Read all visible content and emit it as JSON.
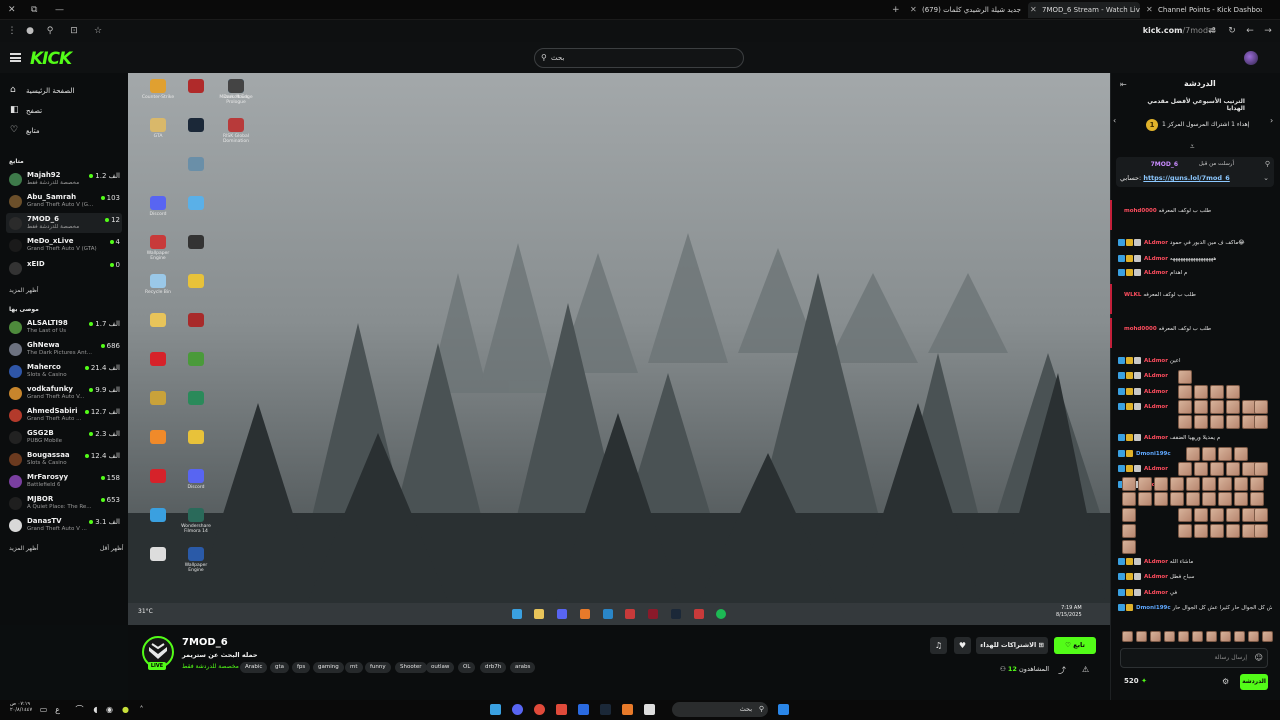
{
  "browser": {
    "tabs": [
      {
        "title": "Channel Points - Kick Dashboar",
        "active": false,
        "favicon_color": "#53fc18"
      },
      {
        "title": "7MOD_6 Stream - Watch Live o",
        "active": true,
        "favicon_color": "#53fc18"
      },
      {
        "title": "(679) جديد شيلة الرشيدي كلمات",
        "active": false,
        "favicon_color": "#ff0033"
      }
    ],
    "url_host": "kick.com",
    "url_path": "/7mod-6"
  },
  "header": {
    "logo": "KICK",
    "search_placeholder": "بحث"
  },
  "sidebar": {
    "nav": [
      {
        "label": "الصفحة الرئيسية",
        "icon": "home-icon",
        "glyph": "⌂"
      },
      {
        "label": "تصفح",
        "icon": "browse-icon",
        "glyph": "◧"
      },
      {
        "label": "متابع",
        "icon": "heart-icon",
        "glyph": "♡"
      }
    ],
    "following_heading": "متابع",
    "following": [
      {
        "name": "Majah92",
        "game": "مخصصة للدردشة فقط",
        "viewers": "الف 1.2",
        "avatar": "#3e7a4a"
      },
      {
        "name": "Abu_Samrah",
        "game": "Grand Theft Auto V (G...",
        "viewers": "103",
        "avatar": "#6b4f2a"
      },
      {
        "name": "7MOD_6",
        "game": "مخصصة للدردشة فقط",
        "viewers": "12",
        "avatar": "#2b2b2b"
      },
      {
        "name": "MeDo_xLive",
        "game": "Grand Theft Auto V (GTA)",
        "viewers": "4",
        "avatar": "#1a1a1a"
      },
      {
        "name": "xEID",
        "game": "",
        "viewers": "0",
        "avatar": "#333"
      }
    ],
    "show_more_1": "أظهر المزيد",
    "recommended_heading": "موصى بها",
    "recommended": [
      {
        "name": "ALSALTI98",
        "game": "The Last of Us",
        "viewers": "الف 1.7",
        "avatar": "#4e8a3c"
      },
      {
        "name": "GhNewa",
        "game": "The Dark Pictures Ant...",
        "viewers": "686",
        "avatar": "#6d7280"
      },
      {
        "name": "Maherco",
        "game": "Slots & Casino",
        "viewers": "الف 21.4",
        "avatar": "#2f56a8"
      },
      {
        "name": "vodkafunky",
        "game": "Grand Theft Auto V...",
        "viewers": "الف 9.9",
        "avatar": "#c7852c"
      },
      {
        "name": "AhmedSabiri",
        "game": "Grand Theft Auto ...",
        "viewers": "الف 12.7",
        "avatar": "#b33a2b"
      },
      {
        "name": "GSG2B",
        "game": "PUBG Mobile",
        "viewers": "الف 2.3",
        "avatar": "#222"
      },
      {
        "name": "Bougassaa",
        "game": "Slots & Casino",
        "viewers": "الف 12.4",
        "avatar": "#6b3a1f"
      },
      {
        "name": "MrFarosyy",
        "game": "Battlefield 6",
        "viewers": "158",
        "avatar": "#7a3fa0"
      },
      {
        "name": "MJBOR",
        "game": "A Quiet Place: The Re...",
        "viewers": "653",
        "avatar": "#1f1f1f"
      },
      {
        "name": "DanasTV",
        "game": "Grand Theft Auto V ...",
        "viewers": "الف 3.1",
        "avatar": "#d8d8d8"
      }
    ],
    "show_more_2": "أظهر المزيد",
    "show_less": "أظهر أقل"
  },
  "desktop": {
    "icons": [
      {
        "label": "Counter-Strike",
        "color": "#e0a030"
      },
      {
        "label": "GTA",
        "color": "#d9b86a"
      },
      {
        "label": "Microsoft Edge",
        "color": "#3aa0e0"
      },
      {
        "label": "Discord",
        "color": "#5865f2"
      },
      {
        "label": "Wallpaper Engine",
        "color": "#c83a3a"
      },
      {
        "label": "Recycle Bin",
        "color": "#9ac8e8"
      },
      {
        "label": "",
        "color": "#e8c45a"
      },
      {
        "label": "",
        "color": "#d6222a"
      },
      {
        "label": "",
        "color": "#c9a23a"
      },
      {
        "label": "",
        "color": "#f08a2a"
      },
      {
        "label": "",
        "color": "#d6222a"
      },
      {
        "label": "",
        "color": "#3aa0e0"
      },
      {
        "label": "",
        "color": "#ddd"
      },
      {
        "label": "",
        "color": "#b02a2a"
      },
      {
        "label": "",
        "color": "#1b2838"
      },
      {
        "label": "",
        "color": "#6a8fa8"
      },
      {
        "label": "",
        "color": "#5ab0e8"
      },
      {
        "label": "",
        "color": "#333"
      },
      {
        "label": "",
        "color": "#e8c23a"
      },
      {
        "label": "",
        "color": "#a82a2a"
      },
      {
        "label": "",
        "color": "#4a9a3a"
      },
      {
        "label": "",
        "color": "#2a8a5a"
      },
      {
        "label": "",
        "color": "#e8c23a"
      },
      {
        "label": "Discord",
        "color": "#5865f2"
      },
      {
        "label": "Wondershare Filmora 14",
        "color": "#2a6a5a"
      },
      {
        "label": "Wallpaper Engine",
        "color": "#2a5aa8"
      },
      {
        "label": "Dark Hours Prologue",
        "color": "#444"
      },
      {
        "label": "RISK Global Domination",
        "color": "#b83a3a"
      },
      {
        "label": "HAXKED",
        "color": "#ddd"
      }
    ],
    "taskbar_time": "7:19 AM",
    "taskbar_date": "8/15/2025",
    "weather": "31°C"
  },
  "chat": {
    "title": "الدردشة",
    "leaderboard": "الترتيب الأسبوعي لأفضل مقدمي الهدايا",
    "gift_line": "إهداء 1 اشتراك المرسول المركز 1",
    "gift_rank": "1",
    "pinned_user": "7MOD_6",
    "pinned_label": "أرسلت من قبل",
    "pinned_text": "حسابي:",
    "pinned_link": "https://guns.lol/7mod_6",
    "messages": [
      {
        "user": "mohd0000",
        "text": "طلب ب لوكف المعرفه",
        "color": "red",
        "badges": 0
      },
      {
        "user": "ALdmor",
        "text": "ماكف ف مين الدبور في حمود😂",
        "color": "red",
        "badges": 3
      },
      {
        "user": "ALdmor",
        "text": "هههههههههههههههههه",
        "color": "red",
        "badges": 3
      },
      {
        "user": "ALdmor",
        "text": "م اهدام",
        "color": "red",
        "badges": 3
      },
      {
        "user": "WLKL",
        "text": "طلب ب لوكف المعرفه",
        "color": "red",
        "badges": 0
      },
      {
        "user": "mohd0000",
        "text": "طلب ب لوكف المعرفه",
        "color": "red",
        "badges": 0
      },
      {
        "user": "ALdmor",
        "text": "اعين",
        "color": "red",
        "badges": 3
      },
      {
        "user": "ALdmor",
        "text": "",
        "color": "red",
        "badges": 3
      },
      {
        "user": "ALdmor",
        "text": "",
        "color": "red",
        "badges": 3
      },
      {
        "user": "ALdmor",
        "text": "",
        "color": "red",
        "badges": 3
      },
      {
        "user": "ALdmor",
        "text": "م يمديلا وريهيا الضفف",
        "color": "red",
        "badges": 3
      },
      {
        "user": "Dmoni199c",
        "text": "",
        "color": "blue",
        "badges": 2
      },
      {
        "user": "ALdmor",
        "text": "",
        "color": "red",
        "badges": 3
      },
      {
        "user": "ALdmor",
        "text": "",
        "color": "red",
        "badges": 3
      },
      {
        "user": "ALdmor",
        "text": "ماشاء الله",
        "color": "red",
        "badges": 3
      },
      {
        "user": "ALdmor",
        "text": "سباح فطل",
        "color": "red",
        "badges": 3
      },
      {
        "user": "ALdmor",
        "text": "في",
        "color": "red",
        "badges": 3
      },
      {
        "user": "Dmoni199c",
        "text": "الكثير! عش كل الجوال حار كثيرا عش كل الجوال حار",
        "color": "blue",
        "badges": 2
      }
    ],
    "input_placeholder": "إرسال رسالة",
    "points": "520",
    "send_label": "الدردشة"
  },
  "stream": {
    "channel": "7MOD_6",
    "title": "حمله البحث عن ستريمر",
    "category": "مخصصة للدردشة فقط",
    "tags": [
      "arabs",
      "drb7h",
      "OL",
      "outlaw",
      "Shooter",
      "funny",
      "mt",
      "gaming",
      "fps",
      "gta",
      "Arabic"
    ],
    "follow_label": "تابع",
    "subscribe_label": "الاشتراكات للهداء",
    "viewers_label": "المشاهدون",
    "viewers": "12",
    "live_badge": "LIVE"
  },
  "windows_taskbar": {
    "search": "بحث",
    "time": "٠٧:١٩ ص",
    "date": "٢٠/٨/١٤٤٧"
  },
  "colors": {
    "accent": "#53fc18",
    "bg": "#0b0e0f"
  }
}
